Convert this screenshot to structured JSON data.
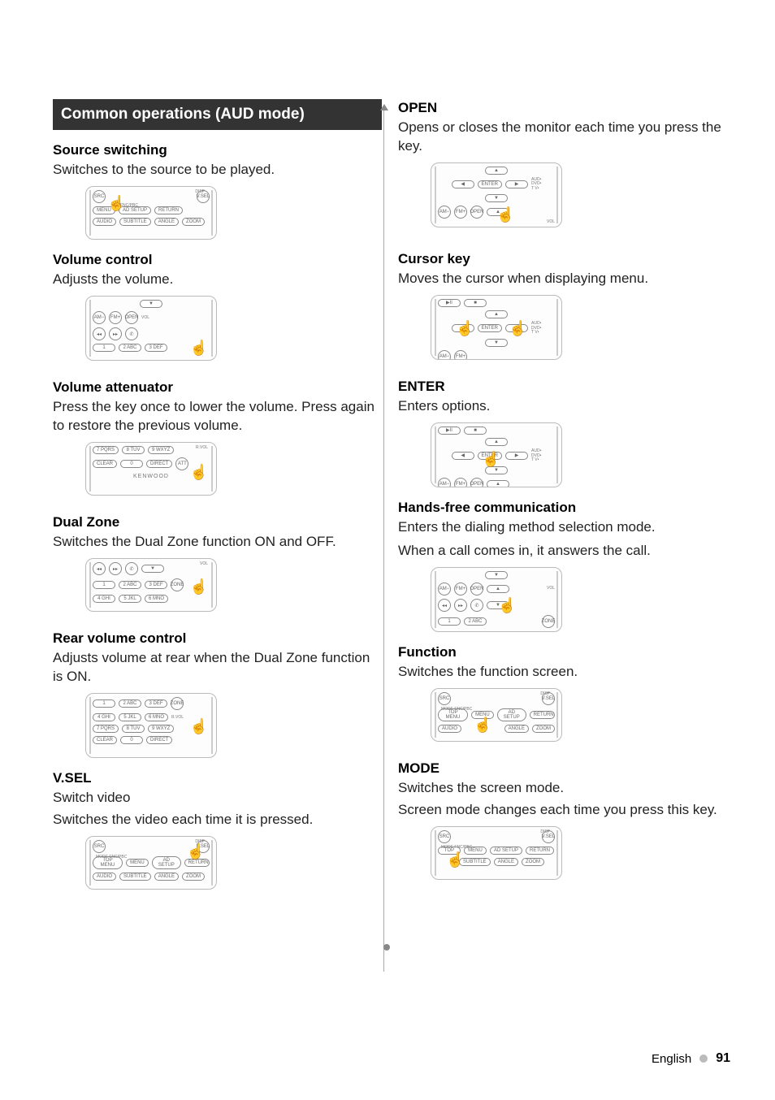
{
  "section_title": "Common operations (AUD mode)",
  "left": {
    "source_switching": {
      "head": "Source switching",
      "body": "Switches to the source to be played."
    },
    "volume_control": {
      "head": "Volume control",
      "body": "Adjusts the volume."
    },
    "volume_attenuator": {
      "head": "Volume attenuator",
      "body": "Press the key once to lower the volume. Press again to restore the previous volume."
    },
    "dual_zone": {
      "head": "Dual Zone",
      "body": "Switches the Dual Zone function ON and OFF."
    },
    "rear_volume": {
      "head": "Rear volume control",
      "body": "Adjusts volume at rear when the Dual Zone function is ON."
    },
    "vsel": {
      "head": "V.SEL",
      "body1": "Switch video",
      "body2": "Switches the video each time it is pressed."
    }
  },
  "right": {
    "open": {
      "head": "OPEN",
      "body": "Opens or closes the monitor each time you press the key."
    },
    "cursor": {
      "head": "Cursor key",
      "body": "Moves the cursor when displaying menu."
    },
    "enter": {
      "head": "ENTER",
      "body": "Enters options."
    },
    "hands_free": {
      "head": "Hands-free communication",
      "body1": "Enters the dialing method selection mode.",
      "body2": "When a call comes in, it answers the call."
    },
    "function": {
      "head": "Function",
      "body": "Switches the function screen."
    },
    "mode": {
      "head": "MODE",
      "body1": "Switches the screen mode.",
      "body2": "Screen mode changes each time you press this key."
    }
  },
  "remote_labels": {
    "disp": "DISP",
    "vsel": "V.SEL",
    "mode_fnc_pbc": "MODE  FNC/PBC",
    "fnc_pbc": "FNC/PBC",
    "menu": "MENU",
    "ad_setup": "AD SETUP",
    "return": "RETURN",
    "audio": "AUDIO",
    "subtitle": "SUBTITLE",
    "angle": "ANGLE",
    "zoom": "ZOOM",
    "am_minus": "AM−",
    "fm_plus": "FM+",
    "open": "OPEN",
    "vol": "VOL",
    "enter": "ENTER",
    "aud": "AUD•",
    "dvd": "DVD•",
    "tv": "T V•",
    "clear": "CLEAR",
    "direct": "DIRECT",
    "att": "ATT",
    "kenwood": "KENWOOD",
    "rvol": "R.VOL",
    "zone": "ZONE",
    "src": "SRC",
    "topmenu": "TOP MENU",
    "n0": "0",
    "n1": "1",
    "n2": "2 ABC",
    "n3": "3 DEF",
    "n4": "4 GHI",
    "n5": "5 JKL",
    "n6": "6 MNO",
    "n7": "7 PQRS",
    "n8": "8 TUV",
    "n9": "9 WXYZ"
  },
  "footer": {
    "lang": "English",
    "page": "91"
  }
}
